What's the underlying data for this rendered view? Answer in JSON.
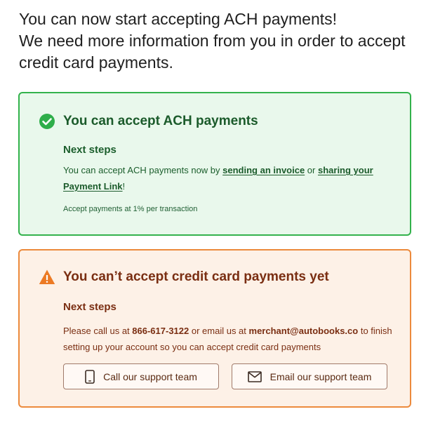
{
  "headline": {
    "line1": "You can now start accepting ACH payments!",
    "line2": "We need more information from you in order to accept",
    "line3": "credit card payments."
  },
  "ach_card": {
    "title": "You can accept ACH payments",
    "subhead": "Next steps",
    "body_prefix": "You can accept ACH payments now by ",
    "link_invoice": "sending an invoice",
    "body_or": " or ",
    "link_payment": "sharing your Payment Link",
    "body_suffix": "!",
    "fine_print": "Accept payments at 1% per transaction",
    "accent_color": "#33b24c",
    "icon": "check-circle-icon"
  },
  "cc_card": {
    "title": "You can’t accept credit card payments yet",
    "subhead": "Next steps",
    "body_prefix": "Please call us at ",
    "phone": "866-617-3122",
    "body_middle": " or email us at ",
    "email": "merchant@autobooks.co",
    "body_suffix": " to finish setting up your account so you can accept credit card payments",
    "call_button": "Call our support team",
    "email_button": "Email our support team",
    "accent_color": "#ec8a3c",
    "icon": "warning-triangle-icon"
  }
}
